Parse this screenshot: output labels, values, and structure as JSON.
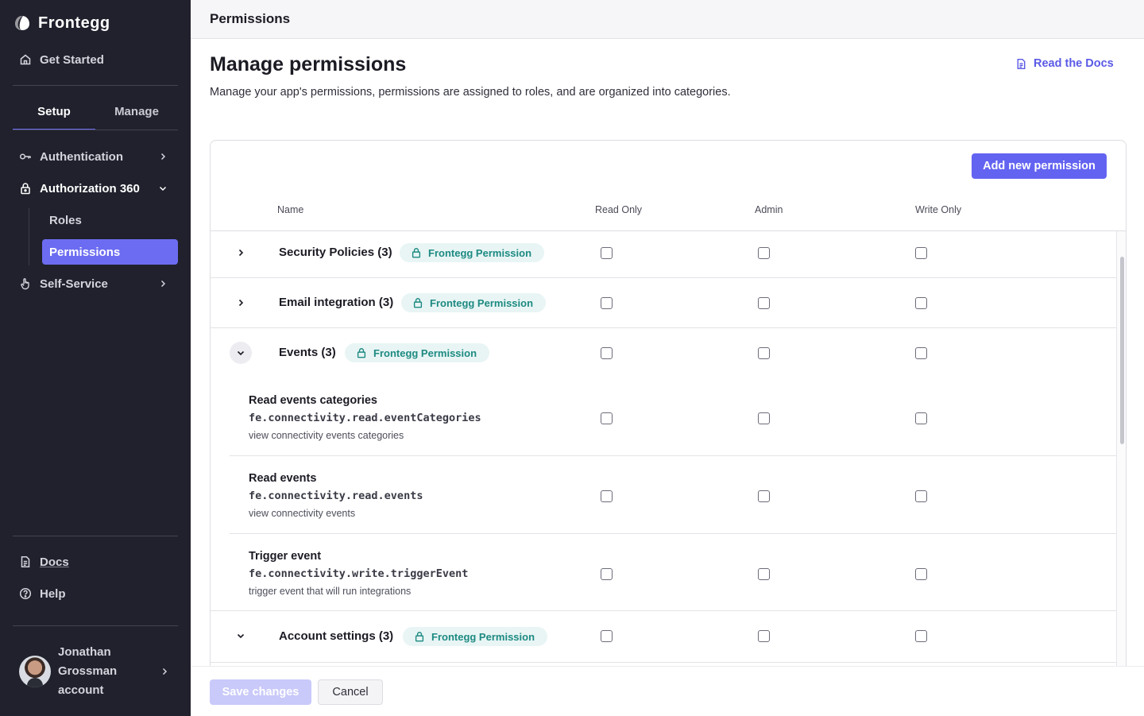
{
  "app": {
    "brand": "Frontegg"
  },
  "sidebar": {
    "get_started": "Get Started",
    "tabs": [
      {
        "label": "Setup",
        "active": true
      },
      {
        "label": "Manage",
        "active": false
      }
    ],
    "items": {
      "authentication": "Authentication",
      "authorization": "Authorization 360",
      "roles": "Roles",
      "permissions": "Permissions",
      "self_service": "Self-Service"
    },
    "bottom": {
      "docs": "Docs",
      "help": "Help"
    },
    "user": {
      "name": "Jonathan Grossman account"
    }
  },
  "header": {
    "title": "Permissions"
  },
  "page": {
    "title": "Manage permissions",
    "description": "Manage your app's permissions, permissions are assigned to roles, and are organized into categories.",
    "docs_link": "Read the Docs"
  },
  "table": {
    "add_button": "Add new permission",
    "columns": [
      "Name",
      "Read Only",
      "Admin",
      "Write Only"
    ],
    "badge_label": "Frontegg Permission",
    "categories": [
      {
        "name": "Security Policies (3)",
        "expanded": false
      },
      {
        "name": "Email integration (3)",
        "expanded": false
      },
      {
        "name": "Events (3)",
        "expanded": true,
        "permissions": [
          {
            "title": "Read events categories",
            "key": "fe.connectivity.read.eventCategories",
            "description": "view connectivity events categories"
          },
          {
            "title": "Read events",
            "key": "fe.connectivity.read.events",
            "description": "view connectivity events"
          },
          {
            "title": "Trigger event",
            "key": "fe.connectivity.write.triggerEvent",
            "description": "trigger event that will run integrations"
          }
        ]
      },
      {
        "name": "Account settings (3)",
        "expanded": true
      }
    ]
  },
  "footer": {
    "save": "Save changes",
    "cancel": "Cancel"
  },
  "colors": {
    "accent": "#6363f1",
    "sidebar_bg": "#20212c",
    "badge_text": "#1d8a82",
    "badge_bg": "#e8f5f4"
  }
}
